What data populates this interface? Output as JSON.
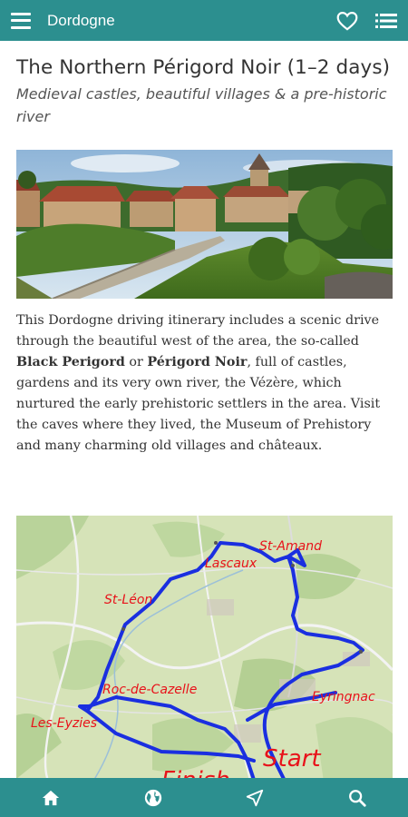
{
  "appbar": {
    "title": "Dordogne",
    "menu_icon": "hamburger-menu-icon",
    "favorite_icon": "heart-outline-icon",
    "list_icon": "list-view-icon"
  },
  "article": {
    "title": "The Northern Périgord Noir (1–2 days)",
    "subtitle": "Medieval castles, beautiful villages & a pre-historic river",
    "body": {
      "part1": "This Dordogne driving itinerary includes a scenic drive through the beautiful west of the area, the so-called ",
      "bold1": "Black Perigord",
      "part2": " or ",
      "bold2": "Périgord Noir",
      "part3": ", full of castles, gardens and its very own river, the Vézère, which nurtured the early prehistoric settlers in the area. Visit the caves where they lived, the Museum of Prehistory and many charming old villages and châteaux."
    }
  },
  "map": {
    "labels": {
      "st_amand": "St-Amand",
      "lascaux": "Lascaux",
      "st_leon": "St-Léon",
      "roc": "Roc-de-Cazelle",
      "les_eyzies": "Les-Eyzies",
      "eyrignac": "Eyringnac",
      "start": "Start",
      "finish": "Finish"
    },
    "route_color": "#1a2fe0",
    "label_color": "#e8121a"
  },
  "bottom_nav": [
    {
      "icon": "home-icon"
    },
    {
      "icon": "globe-icon"
    },
    {
      "icon": "navigation-arrow-icon"
    },
    {
      "icon": "search-icon"
    }
  ],
  "colors": {
    "teal": "#2c8f8f"
  }
}
